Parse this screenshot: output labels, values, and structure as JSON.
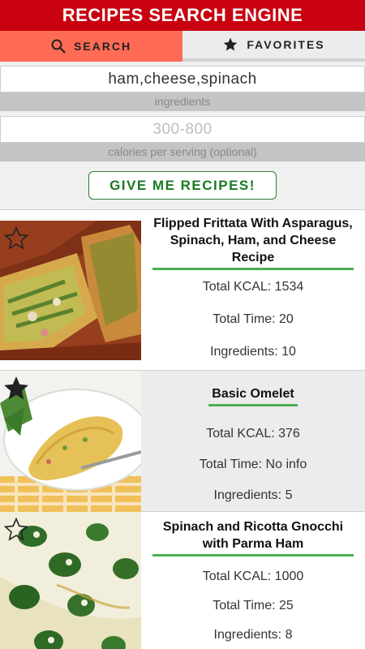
{
  "header": {
    "title": "RECIPES SEARCH ENGINE"
  },
  "tabs": [
    {
      "label": "SEARCH",
      "icon": "search-icon",
      "active": true
    },
    {
      "label": "FAVORITES",
      "icon": "star-icon",
      "active": false
    }
  ],
  "form": {
    "ingredients": {
      "value": "ham,cheese,spinach",
      "hint": "ingredients"
    },
    "calories": {
      "value": "",
      "placeholder": "300-800",
      "hint": "calories per serving (optional)"
    },
    "submit_label": "GIVE ME RECIPES!"
  },
  "results": [
    {
      "title": "Flipped Frittata With Asparagus, Spinach, Ham, and Cheese Recipe",
      "kcal": "Total KCAL: 1534",
      "time": "Total Time: 20",
      "ingredients": "Ingredients: 10",
      "favorite": false
    },
    {
      "title": "Basic Omelet",
      "kcal": "Total KCAL: 376",
      "time": "Total Time: No info",
      "ingredients": "Ingredients: 5",
      "favorite": true
    },
    {
      "title": "Spinach and Ricotta Gnocchi with Parma Ham",
      "kcal": "Total KCAL: 1000",
      "time": "Total Time: 25",
      "ingredients": "Ingredients: 8",
      "favorite": false
    }
  ],
  "colors": {
    "header_bg": "#c8000f",
    "active_tab": "#ff6b54",
    "button_text": "#1b7a23",
    "title_underline": "#4caf50"
  }
}
